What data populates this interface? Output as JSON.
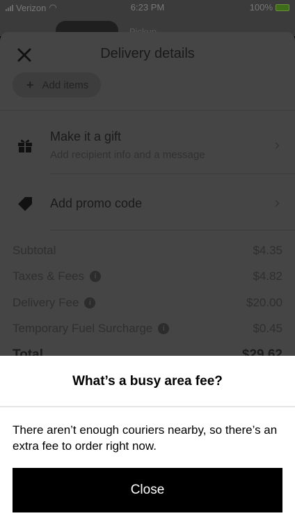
{
  "status_bar": {
    "carrier": "Verizon",
    "time": "6:23 PM",
    "battery": "100%"
  },
  "background_tabs": {
    "visible_text": "Pickup"
  },
  "sheet": {
    "title": "Delivery details",
    "add_items_label": "Add items",
    "gift": {
      "title": "Make it a gift",
      "subtitle": "Add recipient info and a message"
    },
    "promo": {
      "title": "Add promo code"
    },
    "price_lines": [
      {
        "label": "Subtotal",
        "value": "$4.35",
        "info": false
      },
      {
        "label": "Taxes & Fees",
        "value": "$4.82",
        "info": true
      },
      {
        "label": "Delivery Fee",
        "value": "$20.00",
        "info": true
      },
      {
        "label": "Temporary Fuel Surcharge",
        "value": "$0.45",
        "info": true
      }
    ],
    "total": {
      "label": "Total",
      "value": "$29.62"
    }
  },
  "modal": {
    "title": "What’s a busy area fee?",
    "body": "There aren’t enough couriers nearby, so there’s an extra fee to order right now.",
    "button_label": "Close"
  },
  "colors": {
    "overlay": "#454545",
    "modal_bg": "#ffffff",
    "button_bg": "#000000",
    "button_text": "#ffffff"
  }
}
